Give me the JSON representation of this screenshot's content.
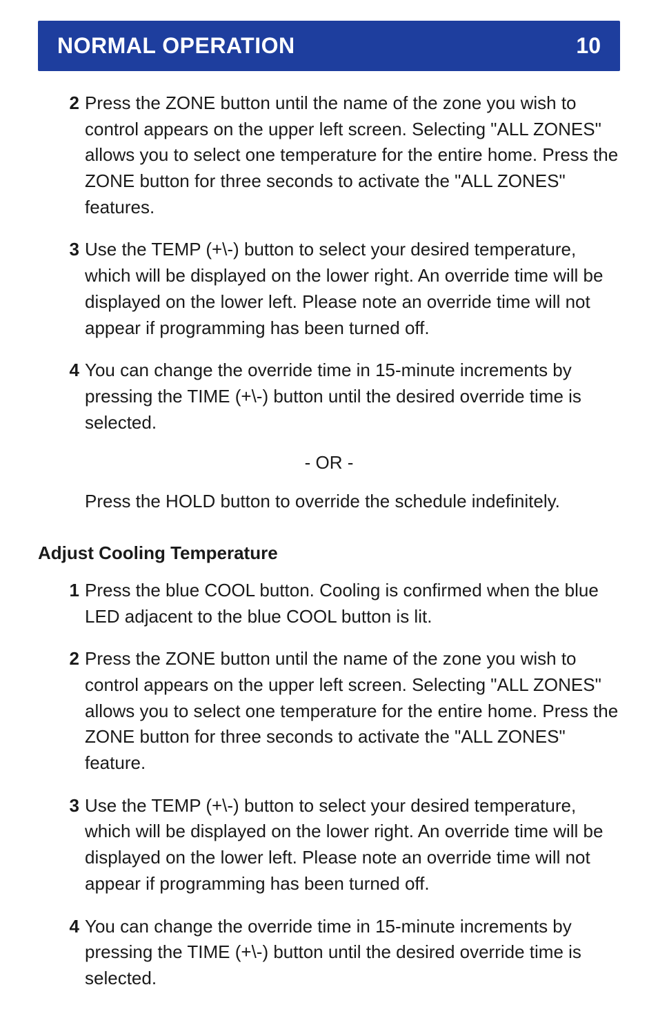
{
  "header": {
    "title": "NORMAL OPERATION",
    "page_number": "10"
  },
  "section1": {
    "steps": [
      {
        "num": "2",
        "text": "Press the ZONE button until the name of the zone you wish to control appears on the upper left screen. Selecting \"ALL ZONES\" allows you to select one temperature for the entire home. Press the ZONE button for three seconds to activate the \"ALL ZONES\" features."
      },
      {
        "num": "3",
        "text": "Use the TEMP (+\\-) button to select your desired temperature, which will be displayed on the lower right. An override time will be displayed on the lower left. Please note an override time will not appear if programming has been turned off."
      },
      {
        "num": "4",
        "text": "You can change the override time in 15-minute increments by pressing the TIME (+\\-) button until the desired override time is selected."
      }
    ],
    "separator": "- OR -",
    "follow": "Press the HOLD button to override the schedule indefinitely."
  },
  "section2": {
    "heading": "Adjust Cooling Temperature",
    "steps": [
      {
        "num": "1",
        "text": "Press the blue COOL button. Cooling is confirmed when the blue LED adjacent to the blue COOL button is lit."
      },
      {
        "num": "2",
        "text": "Press the ZONE button until the name of the zone you wish to control appears on the upper left screen. Selecting \"ALL ZONES\" allows you to select one temperature for the entire home. Press the ZONE button for three seconds to activate the \"ALL ZONES\" feature."
      },
      {
        "num": "3",
        "text": "Use the TEMP (+\\-) button to select your desired temperature, which will be displayed on the lower right. An override time will be displayed on the lower left. Please note an override time will not appear if programming has been turned off."
      },
      {
        "num": "4",
        "text": "You can change the override time in 15-minute increments by pressing the TIME (+\\-) button until the desired override time is selected."
      }
    ]
  }
}
